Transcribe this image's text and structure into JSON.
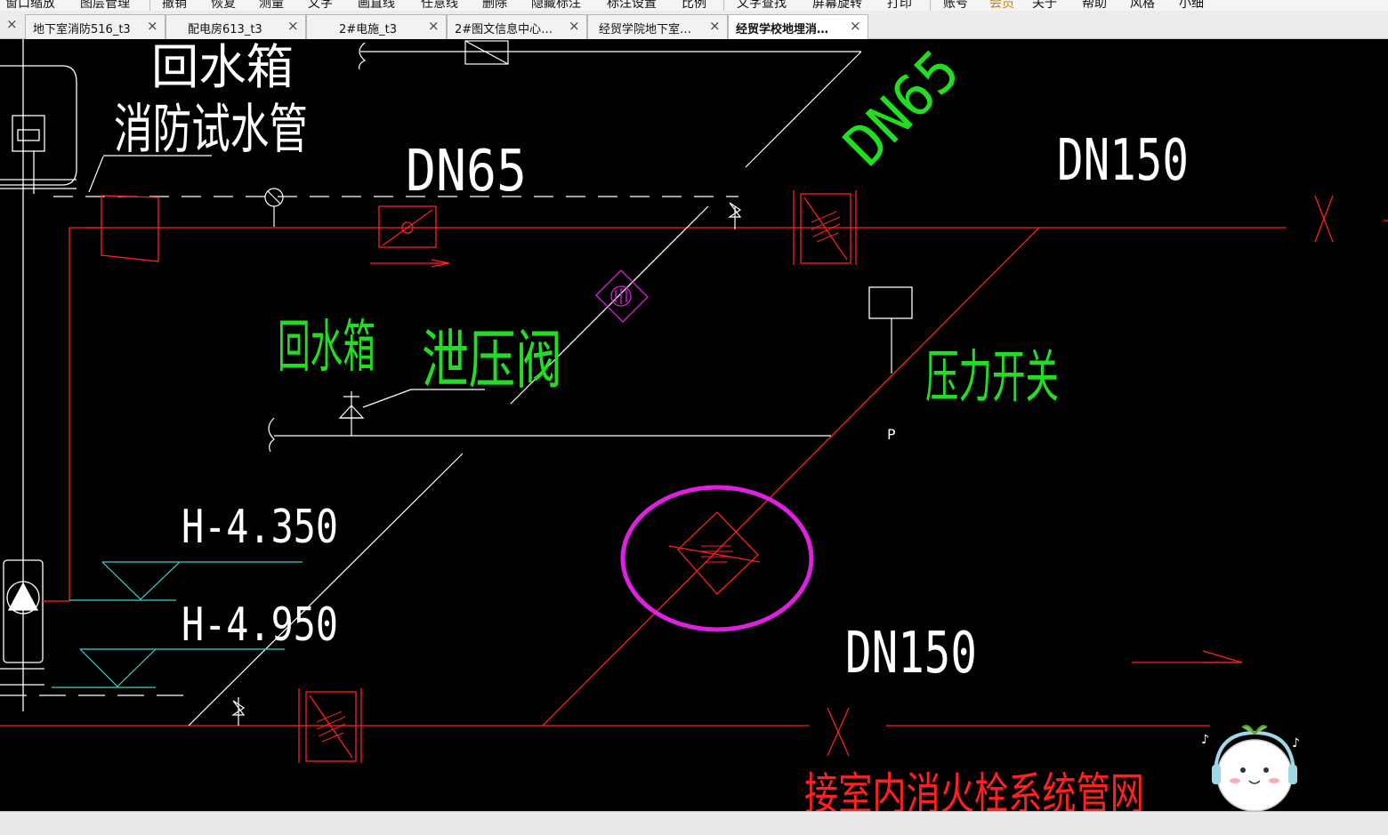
{
  "menubar": {
    "items": [
      "窗口缩放",
      "图层管理",
      "撤销",
      "恢复",
      "测量",
      "文字",
      "画直线",
      "任意线",
      "删除",
      "隐藏标注",
      "标注设置",
      "比例",
      "文字查找",
      "屏幕旋转",
      "打印",
      "账号",
      "会员",
      "关于",
      "帮助",
      "风格",
      "小细"
    ]
  },
  "tabs": [
    {
      "label": "地下室消防516_t3",
      "active": false
    },
    {
      "label": "配电房613_t3",
      "active": false
    },
    {
      "label": "2#电施_t3",
      "active": false
    },
    {
      "label": "2#图文信息中心…",
      "active": false
    },
    {
      "label": "经贸学院地下室…",
      "active": false
    },
    {
      "label": "经贸学校地埋消…",
      "active": true
    }
  ],
  "drawing": {
    "labels": {
      "return_tank_top": "回水箱",
      "test_pipe": "消防试水管",
      "dn65_main": "DN65",
      "dn65_diag": "DN65",
      "dn150_top": "DN150",
      "return_tank": "回水箱",
      "relief_valve": "泄压阀",
      "pressure_switch": "压力开关",
      "p_mark": "P",
      "h1": "H-4.350",
      "h2": "H-4.950",
      "dn150_bottom": "DN150",
      "connect_network": "接室内消火栓系统管网"
    },
    "colors": {
      "pipe": "#ff2020",
      "label_green": "#22dd22",
      "dimension_white": "#ffffff",
      "highlight_magenta": "#e020e0",
      "level_cyan": "#40d0d0",
      "leader_green": "#a0ff60"
    }
  },
  "close_glyph": "×",
  "icons": [
    "close-icon",
    "mascot-icon"
  ]
}
